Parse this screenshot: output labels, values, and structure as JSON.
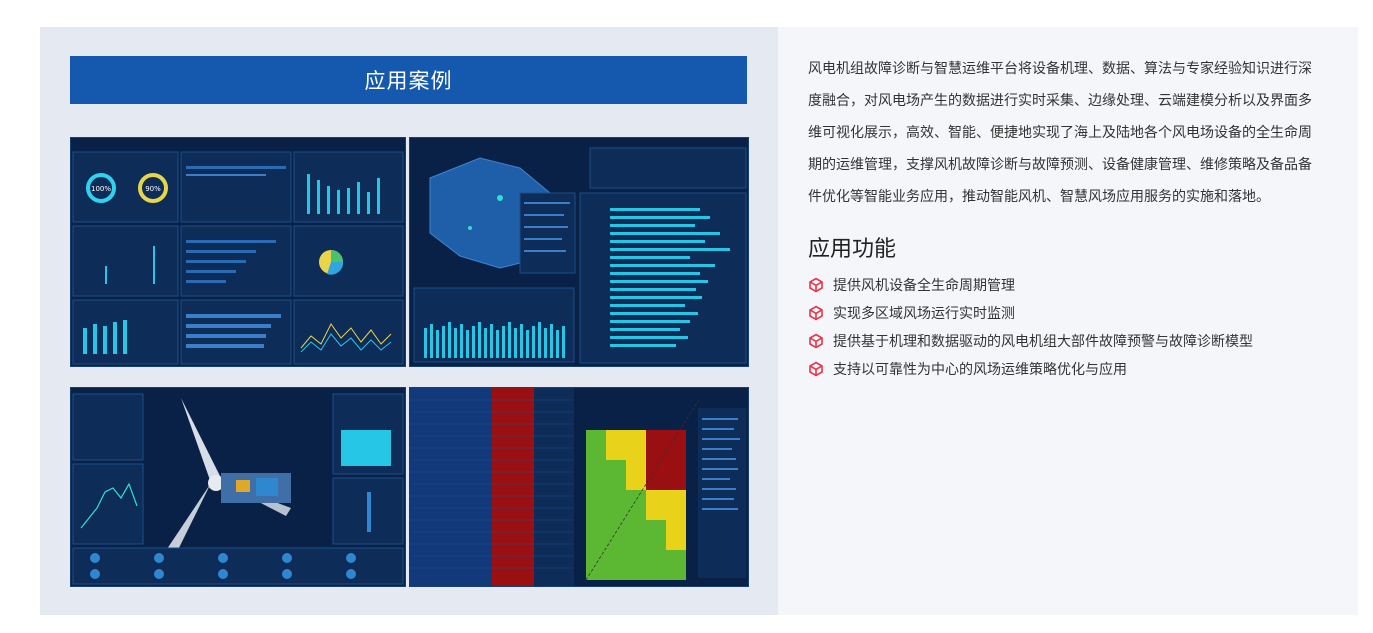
{
  "section": {
    "title": "应用案例"
  },
  "intro": "风电机组故障诊断与智慧运维平台将设备机理、数据、算法与专家经验知识进行深度融合，对风电场产生的数据进行实时采集、边缘处理、云端建模分析以及界面多维可视化展示，高效、智能、便捷地实现了海上及陆地各个风电场设备的全生命周期的运维管理，支撑风机故障诊断与故障预测、设备健康管理、维修策略及备品备件优化等智能业务应用，推动智能风机、智慧风场应用服务的实施和落地。",
  "functions": {
    "title": "应用功能",
    "items": [
      "提供风机设备全生命周期管理",
      "实现多区域风场运行实时监测",
      "提供基于机理和数据驱动的风电机组大部件故障预警与故障诊断模型",
      "支持以可靠性为中心的风场运维策略优化与应用"
    ]
  },
  "colors": {
    "title_bar": "#1459ad",
    "bullet_icon": "#e8354a",
    "dashboard_bg": "#0b2347",
    "chart_cyan": "#26c6e6"
  },
  "screenshots": {
    "shot1": {
      "gauge_a": "100%",
      "gauge_b": "90%"
    }
  }
}
